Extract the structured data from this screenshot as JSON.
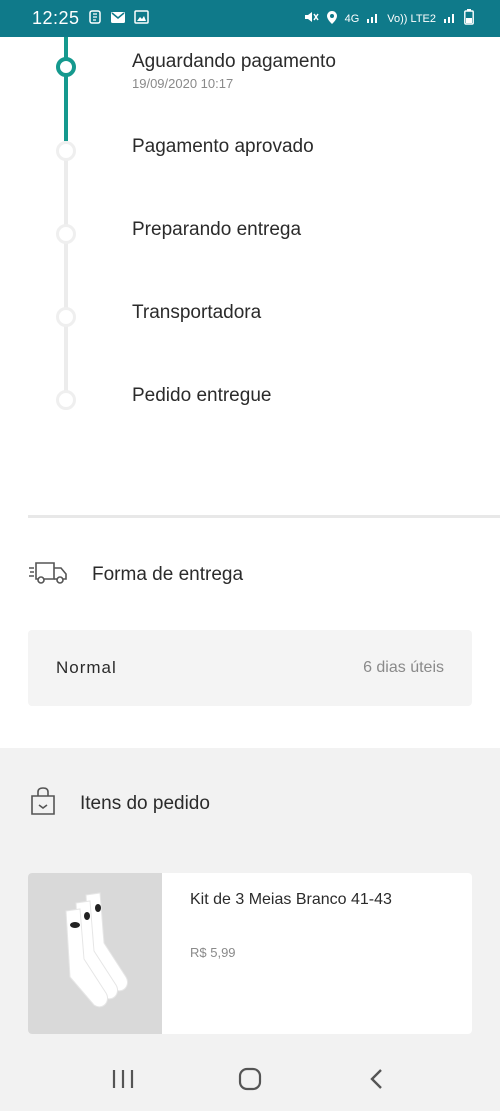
{
  "status_bar": {
    "time": "12:25",
    "network_label": "4G",
    "volte_label": "Vo)) LTE2"
  },
  "timeline": {
    "steps": [
      {
        "label": "Aguardando pagamento",
        "date": "19/09/2020 10:17",
        "active": true
      },
      {
        "label": "Pagamento aprovado",
        "active": false
      },
      {
        "label": "Preparando entrega",
        "active": false
      },
      {
        "label": "Transportadora",
        "active": false
      },
      {
        "label": "Pedido entregue",
        "active": false
      }
    ],
    "progress_color": "#15998e"
  },
  "delivery": {
    "title": "Forma de entrega",
    "icon": "truck-icon",
    "method": "Normal",
    "time": "6 dias úteis"
  },
  "items": {
    "title": "Itens do pedido",
    "icon": "shopping-bag-icon",
    "list": [
      {
        "name": "Kit de 3 Meias Branco 41-43",
        "price": "R$  5,99"
      }
    ]
  },
  "nav": {
    "buttons": [
      "recent-apps",
      "home",
      "back"
    ]
  }
}
